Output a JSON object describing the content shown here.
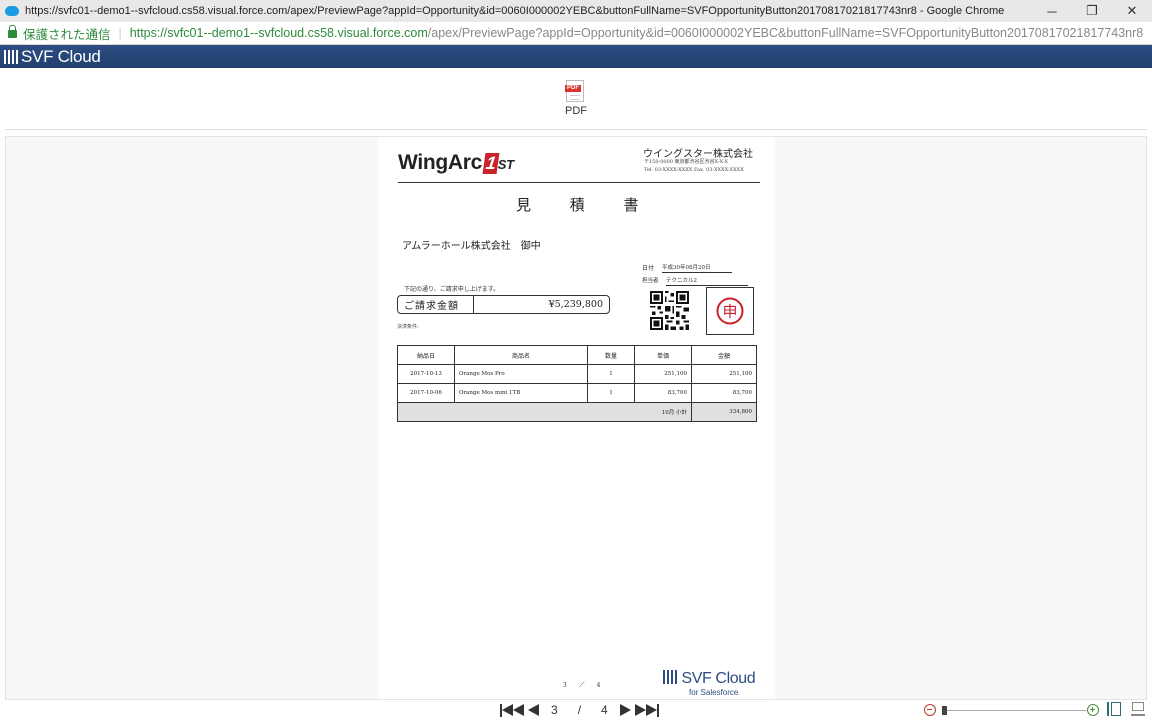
{
  "browser": {
    "window_title": "https://svfc01--demo1--svfcloud.cs58.visual.force.com/apex/PreviewPage?appId=Opportunity&id=0060I000002YEBC&buttonFullName=SVFOpportunityButton20170817021817743nr8 - Google Chrome",
    "secure_label": "保護された通信",
    "url_host": "https://svfc01--demo1--svfcloud.cs58.visual.force.com",
    "url_path": "/apex/PreviewPage?appId=Opportunity&id=0060I000002YEBC&buttonFullName=SVFOpportunityButton20170817021817743nr8",
    "minimize_glyph": "─",
    "restore_glyph": "❐",
    "close_glyph": "✕"
  },
  "app": {
    "logo_text": "SVF Cloud"
  },
  "toolbar": {
    "pdf_tag": "PDF",
    "pdf_label": "PDF"
  },
  "document": {
    "brand": "WingArc",
    "brand_one": "1",
    "brand_st": "ST",
    "issuer": "ウイングスター株式会社",
    "issuer_address": "〒150-0000 東京都渋谷区渋谷X-X-X",
    "issuer_tel": "Tel. 03-XXXX-XXXX  Fax. 03-XXXX-XXXX",
    "title": "見 積 書",
    "customer": "アムラーホール株式会社　御中",
    "date_label": "日付",
    "date_value": "平成30年08月20日",
    "staff_label": "担当者",
    "staff_value": "テクニカル2",
    "notice": "下記の通り、ご請求申し上げます。",
    "amount_label": "ご請求金額",
    "amount_value": "¥5,239,800",
    "payment_terms": "決済条件:",
    "stamp_char": "申",
    "table": {
      "headers": [
        "納品日",
        "商品名",
        "数量",
        "単価",
        "金額"
      ],
      "rows": [
        {
          "date": "2017-10-13",
          "item": "Orange  Mos Pro",
          "qty": "1",
          "price": "251,100",
          "amount": "251,100"
        },
        {
          "date": "2017-10-06",
          "item": "Orange  Mos mini 1TB",
          "qty": "1",
          "price": "83,700",
          "amount": "83,700"
        }
      ],
      "subtotal_label": "10月 小計",
      "subtotal_value": "334,800"
    },
    "page_indicator": "3 ／ 4",
    "footer_logo": "SVF Cloud",
    "footer_sub": "for Salesforce"
  },
  "pager": {
    "current": "3",
    "separator": "/",
    "total": "4"
  },
  "colors": {
    "header_bar": "#22406f",
    "secure_green": "#2e8b3a",
    "stamp_red": "#c8222a"
  }
}
